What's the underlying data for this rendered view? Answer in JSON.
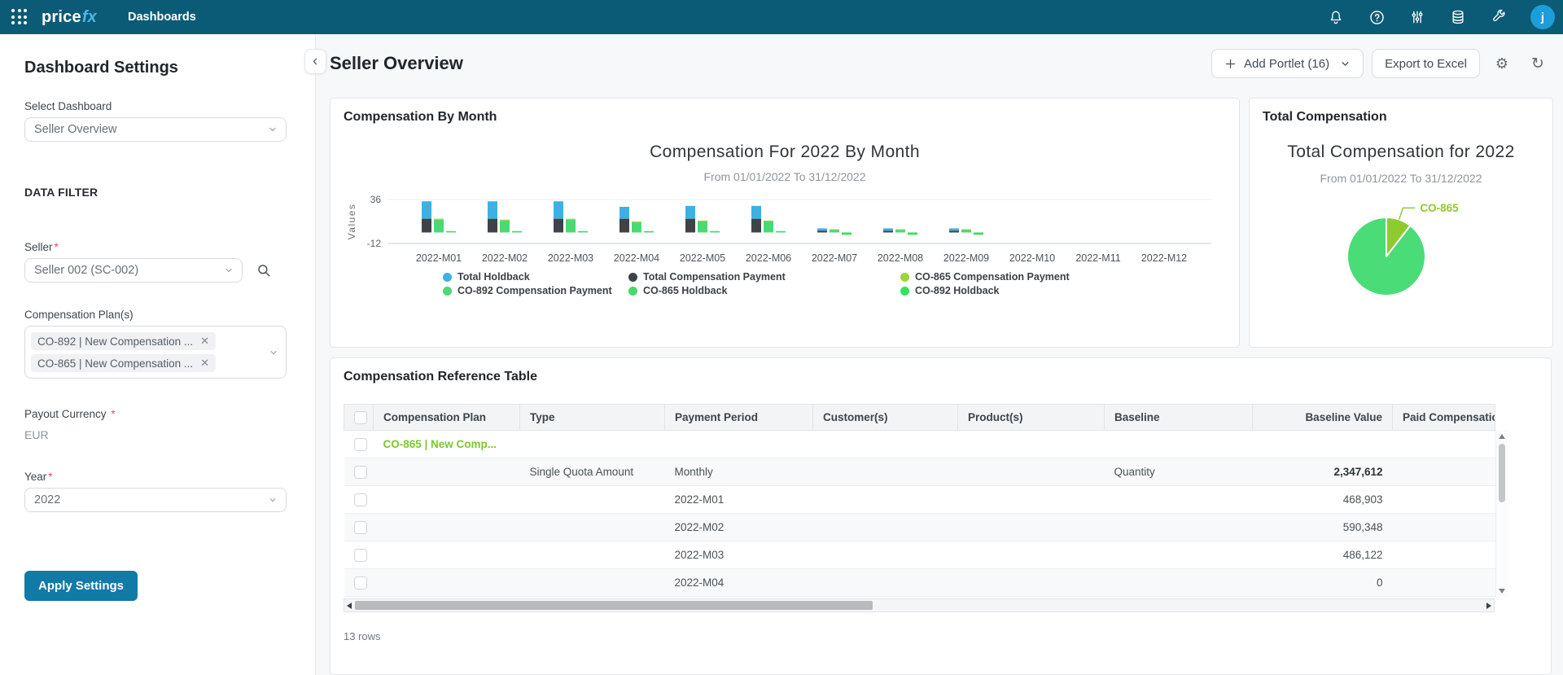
{
  "navbar": {
    "logo_price": "price",
    "logo_fx": "fx",
    "nav_item": "Dashboards",
    "avatar_initial": "j"
  },
  "sidebar": {
    "title": "Dashboard Settings",
    "select_dashboard_label": "Select Dashboard",
    "select_dashboard_value": "Seller Overview",
    "section_title": "DATA FILTER",
    "seller_label": "Seller",
    "seller_value": "Seller 002 (SC-002)",
    "plans_label": "Compensation Plan(s)",
    "plan_tags": [
      "CO-892 | New Compensation ...",
      "CO-865 | New Compensation ..."
    ],
    "payout_label": "Payout Currency",
    "payout_value": "EUR",
    "year_label": "Year",
    "year_value": "2022",
    "apply_button": "Apply Settings",
    "required_marker": "*"
  },
  "main": {
    "title": "Seller Overview",
    "add_portlet_button": "Add Portlet (16)",
    "export_button": "Export to Excel"
  },
  "chart_data": [
    {
      "type": "bar",
      "portlet_title": "Compensation By Month",
      "title": "Compensation For 2022 By Month",
      "subtitle": "From 01/01/2022 To 31/12/2022",
      "xlabel": "",
      "ylabel": "Values",
      "ylim": [
        -12,
        36
      ],
      "yticks": [
        36,
        -12
      ],
      "grid": false,
      "legend_position": "bottom",
      "categories": [
        "2022-M01",
        "2022-M02",
        "2022-M03",
        "2022-M04",
        "2022-M05",
        "2022-M06",
        "2022-M07",
        "2022-M08",
        "2022-M09",
        "2022-M10",
        "2022-M11",
        "2022-M12"
      ],
      "series": [
        {
          "name": "Total Compensation Payment",
          "stack": "total",
          "color": "#3f4347",
          "values": [
            15,
            15,
            15,
            15,
            15,
            15,
            2,
            2,
            2,
            0,
            0,
            0
          ]
        },
        {
          "name": "Total Holdback",
          "stack": "total",
          "color": "#3db1e4",
          "values": [
            19,
            19,
            19,
            13,
            14,
            14,
            2.5,
            2.5,
            2.5,
            0,
            0,
            0
          ]
        },
        {
          "name": "CO-892 Compensation Payment",
          "stack": "comp",
          "color": "#4bd973",
          "values": [
            14,
            13,
            14,
            11,
            12,
            12,
            3,
            3,
            3,
            0,
            0,
            0
          ]
        },
        {
          "name": "CO-865 Compensation Payment",
          "stack": "comp",
          "color": "#9dd53a",
          "values": [
            1,
            1,
            1,
            1,
            1,
            1,
            0.5,
            0.5,
            0.5,
            0,
            0,
            0
          ]
        },
        {
          "name": "CO-865 Holdback",
          "stack": "hold",
          "color": "#45d96e",
          "values": [
            1.5,
            1.5,
            1.5,
            1.5,
            1.5,
            1.5,
            0,
            0,
            0,
            0,
            0,
            0
          ]
        },
        {
          "name": "CO-892 Holdback",
          "stack": "hold",
          "color": "#35e15e",
          "values": [
            0,
            0,
            0,
            0,
            0,
            0,
            -2.5,
            -2.5,
            -2.5,
            0,
            0,
            0
          ]
        }
      ],
      "legend": [
        {
          "label": "Total Holdback",
          "color": "#3db1e4"
        },
        {
          "label": "Total Compensation Payment",
          "color": "#3f4347"
        },
        {
          "label": "CO-865 Compensation Payment",
          "color": "#9dd53a"
        },
        {
          "label": "CO-892 Compensation Payment",
          "color": "#4bd973"
        },
        {
          "label": "CO-865 Holdback",
          "color": "#45d96e"
        },
        {
          "label": "CO-892 Holdback",
          "color": "#35e15e"
        }
      ]
    },
    {
      "type": "pie",
      "portlet_title": "Total Compensation",
      "title": "Total Compensation for 2022",
      "subtitle": "From 01/01/2022 To 31/12/2022",
      "slices": [
        {
          "label": "CO-865",
          "percent": 10.5,
          "color": "#8ecb2f",
          "labeled": true
        },
        {
          "label": "",
          "percent": 89.5,
          "color": "#4adc77",
          "labeled": false
        }
      ]
    }
  ],
  "table": {
    "title": "Compensation Reference Table",
    "columns": [
      "Compensation Plan",
      "Type",
      "Payment Period",
      "Customer(s)",
      "Product(s)",
      "Baseline",
      "Baseline Value",
      "Paid Compensation"
    ],
    "rows": [
      {
        "plan": "CO-865 | New Comp...",
        "type": "",
        "period": "",
        "customers": "",
        "products": "",
        "baseline": "",
        "baseline_value": "",
        "paid": "",
        "plan_is_link": true
      },
      {
        "plan": "",
        "type": "Single Quota Amount",
        "period": "Monthly",
        "customers": "",
        "products": "",
        "baseline": "Quantity",
        "baseline_value": "2,347,612",
        "paid": "",
        "emphasis": true
      },
      {
        "plan": "",
        "type": "",
        "period": "2022-M01",
        "customers": "",
        "products": "",
        "baseline": "",
        "baseline_value": "468,903",
        "paid": ""
      },
      {
        "plan": "",
        "type": "",
        "period": "2022-M02",
        "customers": "",
        "products": "",
        "baseline": "",
        "baseline_value": "590,348",
        "paid": ""
      },
      {
        "plan": "",
        "type": "",
        "period": "2022-M03",
        "customers": "",
        "products": "",
        "baseline": "",
        "baseline_value": "486,122",
        "paid": ""
      },
      {
        "plan": "",
        "type": "",
        "period": "2022-M04",
        "customers": "",
        "products": "",
        "baseline": "",
        "baseline_value": "0",
        "paid": ""
      }
    ],
    "status": "13 rows"
  }
}
